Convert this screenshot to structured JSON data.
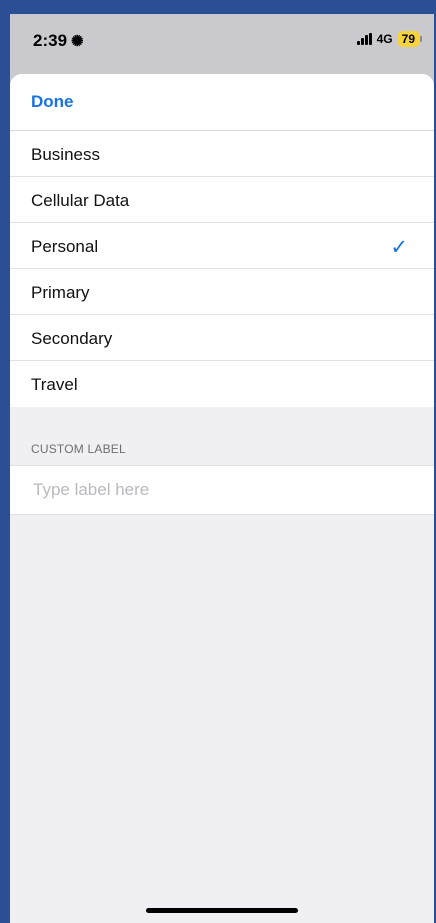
{
  "status_bar": {
    "time": "2:39",
    "status_icon": "focus-glyph",
    "network": "4G",
    "battery": "79"
  },
  "toolbar": {
    "done_label": "Done"
  },
  "options": [
    {
      "label": "Business",
      "selected": false
    },
    {
      "label": "Cellular Data",
      "selected": false
    },
    {
      "label": "Personal",
      "selected": true
    },
    {
      "label": "Primary",
      "selected": false
    },
    {
      "label": "Secondary",
      "selected": false
    },
    {
      "label": "Travel",
      "selected": false
    }
  ],
  "custom_label": {
    "header": "CUSTOM LABEL",
    "placeholder": "Type label here",
    "value": ""
  },
  "colors": {
    "accent": "#1b73e0",
    "battery": "#f5d33a",
    "background": "#2b4f95"
  }
}
